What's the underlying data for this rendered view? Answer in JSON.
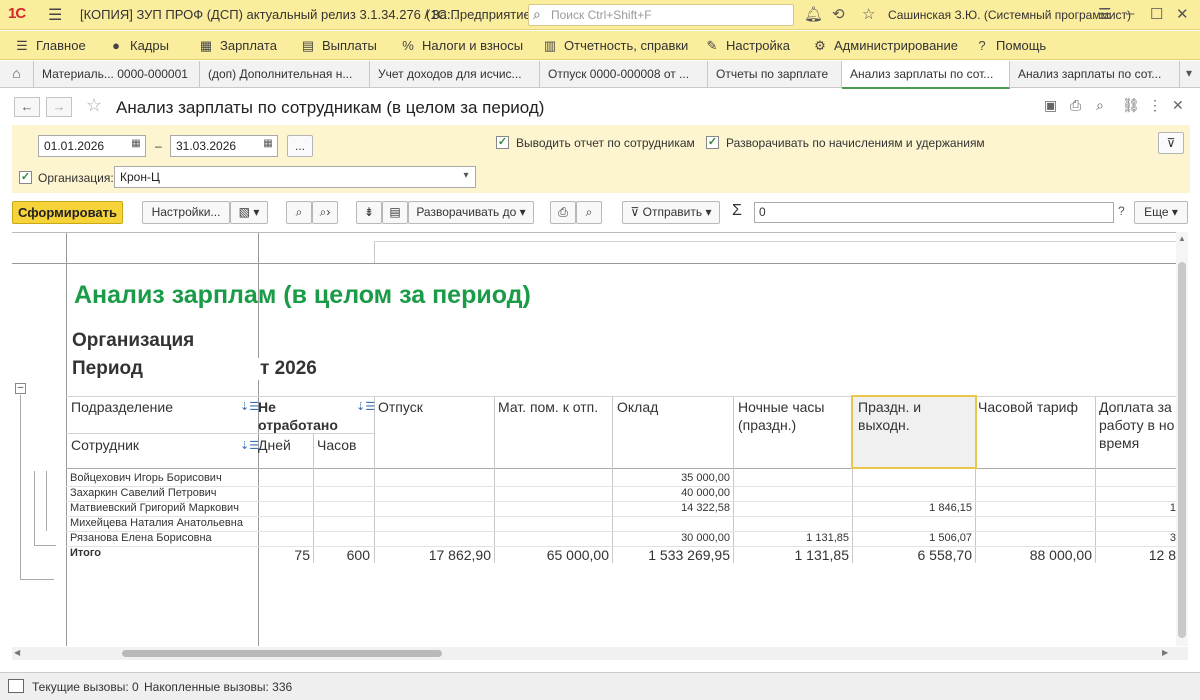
{
  "titlebar": {
    "logo": "1С",
    "app_title": "[КОПИЯ] ЗУП ПРОФ (ДСП) актуальный релиз 3.1.34.276 / За...",
    "app_subtitle": "(1С:Предприятие)",
    "search_placeholder": "Поиск Ctrl+Shift+F",
    "user": "Сашинская З.Ю. (Системный программист)"
  },
  "menu": [
    {
      "icon": "menu-icon",
      "glyph": "☰",
      "label": "Главное"
    },
    {
      "icon": "people-icon",
      "glyph": "👥",
      "label": "Кадры"
    },
    {
      "icon": "calculator-icon",
      "glyph": "▦",
      "label": "Зарплата"
    },
    {
      "icon": "payment-icon",
      "glyph": "▤",
      "label": "Выплаты"
    },
    {
      "icon": "percent-icon",
      "glyph": "%",
      "label": "Налоги и взносы"
    },
    {
      "icon": "report-icon",
      "glyph": "▥",
      "label": "Отчетность, справки"
    },
    {
      "icon": "wrench-icon",
      "glyph": "🔧",
      "label": "Настройка"
    },
    {
      "icon": "gear-icon",
      "glyph": "⚙",
      "label": "Администрирование"
    },
    {
      "icon": "question-icon",
      "glyph": "?",
      "label": "Помощь"
    }
  ],
  "tabs": [
    {
      "label": "Материаль... 0000-000001",
      "active": false
    },
    {
      "label": "(доп) Дополнительная н...",
      "active": false
    },
    {
      "label": "Учет доходов для исчис...",
      "active": false
    },
    {
      "label": "Отпуск 0000-000008 от ...",
      "active": false
    },
    {
      "label": "Отчеты по зарплате",
      "active": false
    },
    {
      "label": "Анализ зарплаты по сот...",
      "active": true
    },
    {
      "label": "Анализ зарплаты по сот...",
      "active": false
    }
  ],
  "form": {
    "title": "Анализ зарплаты по сотрудникам (в целом за период)"
  },
  "settings": {
    "date_from": "01.01.2026",
    "date_sep": "–",
    "date_to": "31.03.2026",
    "more": "...",
    "show_by_employee": "Выводить отчет по сотрудникам",
    "expand_by_accruals": "Разворачивать по начислениям и удержаниям",
    "org_label": "Организация:",
    "org_value": "Крон-Ц"
  },
  "toolbar": {
    "generate": "Сформировать",
    "settings": "Настройки...",
    "expand_to": "Разворачивать до",
    "send": "Отправить",
    "sum_value": "0",
    "help": "?",
    "more": "Еще"
  },
  "report": {
    "title": "Анализ зарплам (в целом за период)",
    "org_label": "Организация",
    "period_label": "Период",
    "period_value": "т 2026",
    "headers": {
      "department": "Подразделение",
      "employee": "Сотрудник",
      "not_worked_1": "Не",
      "not_worked_2": "отработано",
      "days": "Дней",
      "hours": "Часов",
      "vacation": "Отпуск",
      "mat_help_1": "Мат. пом. к отп.",
      "salary": "Оклад",
      "night_1": "Ночные часы",
      "night_2": "(праздн.)",
      "holiday_1": "Праздн. и",
      "holiday_2": "выходн.",
      "hourly": "Часовой тариф",
      "extra_1": "Доплата за",
      "extra_2": "работу в но",
      "extra_3": "время"
    },
    "rows": [
      {
        "name": "Войцехович Игорь Борисович",
        "salary": "35 000,00",
        "night": "",
        "holiday": "",
        "extra": ""
      },
      {
        "name": "Захаркин Савелий Петрович",
        "salary": "40 000,00",
        "night": "",
        "holiday": "",
        "extra": ""
      },
      {
        "name": "Матвиевский Григорий Маркович",
        "salary": "14 322,58",
        "night": "",
        "holiday": "1 846,15",
        "extra": "1"
      },
      {
        "name": "Михейцева Наталия Анатольевна",
        "salary": "",
        "night": "",
        "holiday": "",
        "extra": ""
      },
      {
        "name": "Рязанова Елена Борисовна",
        "salary": "30 000,00",
        "night": "1 131,85",
        "holiday": "1 506,07",
        "extra": "3"
      }
    ],
    "total": {
      "label": "Итого",
      "days": "75",
      "hours": "600",
      "vacation": "17 862,90",
      "mat_help": "65 000,00",
      "salary": "1 533 269,95",
      "night": "1 131,85",
      "holiday": "6 558,70",
      "hourly": "88 000,00",
      "extra": "12 8"
    }
  },
  "status": {
    "current_calls": "Текущие вызовы: 0",
    "accumulated_calls": "Накопленные вызовы: 336"
  }
}
